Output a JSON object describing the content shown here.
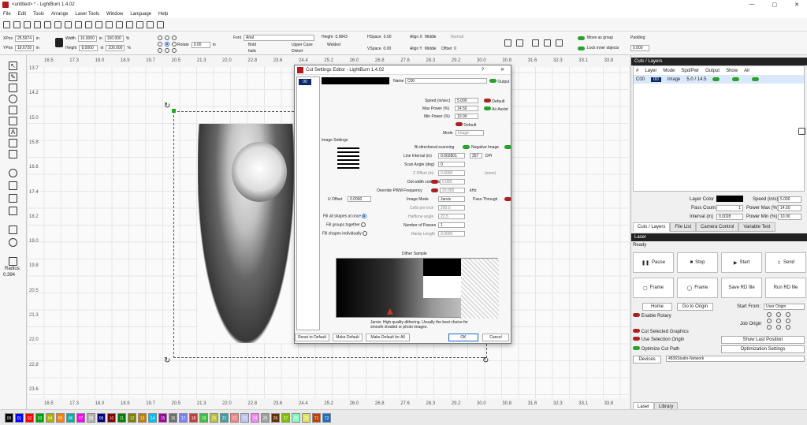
{
  "window": {
    "title": "<untitled> * - LightBurn 1.4.02",
    "controls": [
      "—",
      "▢",
      "✕"
    ]
  },
  "menu": [
    "File",
    "Edit",
    "Tools",
    "Arrange",
    "Laser Tools",
    "Window",
    "Language",
    "Help"
  ],
  "props": {
    "xpos_label": "XPos",
    "xpos": "25.5974",
    "ypos_label": "YPos",
    "ypos": "18.6728",
    "unit": "in",
    "width_label": "Width",
    "width": "10.0000",
    "height_label": "Height",
    "height": "8.0000",
    "wpct": "100.000",
    "hpct": "100.000",
    "pct": "%",
    "rotate_label": "Rotate",
    "rotate": "0.00",
    "font_label": "Font",
    "font": "Arial",
    "fheight_label": "Height",
    "fheight": "0.9843",
    "hspace_label": "HSpace",
    "hspace": "0.00",
    "vspace_label": "VSpace",
    "vspace": "0.00",
    "alignx_label": "Align X",
    "alignx": "Middle",
    "aligny_label": "Align Y",
    "aligny": "Middle",
    "normal": "Normal",
    "offset_label": "Offset",
    "offset": "0",
    "bold": "Bold",
    "italic": "Italic",
    "upper": "Upper Case",
    "distort": "Distort",
    "welded": "Welded",
    "move_group": "Move as group",
    "lock_inner": "Lock inner objects",
    "padding_label": "Padding:",
    "padding": "0.000"
  },
  "rulers": {
    "top": [
      "16.5",
      "17.3",
      "18.0",
      "18.9",
      "19.7",
      "20.5",
      "21.3",
      "22.0",
      "22.8",
      "23.6",
      "24.4",
      "25.2",
      "26.0",
      "26.8",
      "27.6",
      "28.3",
      "29.2",
      "30.0",
      "30.8",
      "31.6",
      "32.3",
      "33.1",
      "33.8"
    ],
    "left": [
      "13.7",
      "14.2",
      "15.0",
      "15.8",
      "16.6",
      "17.4",
      "18.2",
      "19.0",
      "19.8",
      "20.5",
      "21.3",
      "22.0",
      "22.8",
      "23.6"
    ],
    "radius_label": "Radius:",
    "radius": "0.394"
  },
  "dialog": {
    "title": "Cut Settings Editor - LightBurn 1.4.02",
    "help": "?",
    "close": "✕",
    "list_item": "00",
    "name_label": "Name",
    "name": "C00",
    "output": "Output",
    "speed_label": "Speed (in/sec)",
    "speed": "5.000",
    "default_label": "Default",
    "max_power_label": "Max Power (%)",
    "max_power": "14.50",
    "air_assist": "Air Assist",
    "min_power_label": "Min Power (%)",
    "min_power": "10.00",
    "default_btn": "Default",
    "mode_label": "Mode",
    "mode": "Image",
    "image_settings": "Image Settings",
    "bidir": "Bi-directional scanning",
    "negative": "Negative Image",
    "line_interval_label": "Line Interval (in)",
    "line_interval": "0.002801",
    "dpi": "357",
    "dpi_label": "DPI",
    "scan_angle_label": "Scan Angle (deg)",
    "scan_angle": "0",
    "z_offset_label": "Z Offset (in)",
    "z_offset": "0.0000",
    "none": "(none)",
    "dot_width_label": "Dot width correction",
    "dot_width": "0.080",
    "override_label": "Override PWM Frequency",
    "override": "20.000",
    "khz": "kHz",
    "u_offset_label": "U Offset",
    "u_offset": "0.0000",
    "image_mode_label": "Image Mode",
    "image_mode": "Jarvis",
    "pass_through": "Pass-Through",
    "cells_label": "Cells per inch",
    "cells": "200.0",
    "halftone_label": "Halftone angle",
    "halftone": "22.5",
    "passes_label": "Number of Passes",
    "passes": "1",
    "ramp_label": "Ramp Length",
    "ramp": "0.0000",
    "fill_all": "Fill all shapes at once",
    "fill_groups": "Fill groups together",
    "fill_indiv": "Fill shapes individually",
    "dither_title": "Dither Sample",
    "dither_caption": "Jarvis: High quality dithering. Usually the best choice for smooth shaded or photo images.",
    "btn_reset": "Reset to Default",
    "btn_make": "Make Default",
    "btn_make_all": "Make Default for All",
    "btn_ok": "OK",
    "btn_cancel": "Cancel"
  },
  "layers": {
    "header": "Cuts / Layers",
    "columns": [
      "#",
      "Layer",
      "Mode",
      "Spd/Pwr",
      "Output",
      "Show",
      "Air"
    ],
    "row": {
      "num": "C00",
      "layer": "00",
      "mode": "Image",
      "spdpwr": "5.0 / 14.5"
    },
    "layer_color_label": "Layer Color",
    "speed_label": "Speed (in/s)",
    "speed": "5.000",
    "pass_count_label": "Pass Count",
    "pass_count": "1",
    "power_max_label": "Power Max (%)",
    "power_max": "14.50",
    "interval_label": "Interval (in)",
    "interval": "0.0028",
    "power_min_label": "Power Min (%)",
    "power_min": "10.00",
    "image_label": "Image",
    "tabs": [
      "Cuts / Layers",
      "File List",
      "Camera Control",
      "Variable Text"
    ]
  },
  "laser": {
    "header": "Laser",
    "status": "Ready",
    "pause": "Pause",
    "stop": "Stop",
    "start": "Start",
    "send": "Send",
    "frame1": "Frame",
    "frame2": "Frame",
    "save_rd": "Save RD file",
    "run_rd": "Run RD file",
    "home": "Home",
    "go_origin": "Go to Origin",
    "start_from_label": "Start From:",
    "start_from": "User Origin",
    "enable_rotary": "Enable Rotary",
    "job_origin": "Job Origin",
    "cut_selected": "Cut Selected Graphics",
    "use_selection_origin": "Use Selection Origin",
    "show_last": "Show Last Position",
    "optimize": "Optimize Cut Path",
    "opt_settings": "Optimization Settings",
    "devices": "Devices",
    "device": "4836Studio-Network",
    "tabs": [
      "Laser",
      "Library"
    ]
  },
  "palette": [
    {
      "label": "00",
      "color": "#000000"
    },
    {
      "label": "01",
      "color": "#0000ff"
    },
    {
      "label": "02",
      "color": "#ff0000"
    },
    {
      "label": "03",
      "color": "#00a000"
    },
    {
      "label": "04",
      "color": "#b0b000"
    },
    {
      "label": "05",
      "color": "#ff8000"
    },
    {
      "label": "06",
      "color": "#00b0b0"
    },
    {
      "label": "07",
      "color": "#ff00ff"
    },
    {
      "label": "08",
      "color": "#b4b4b4"
    },
    {
      "label": "09",
      "color": "#000080"
    },
    {
      "label": "10",
      "color": "#800000"
    },
    {
      "label": "11",
      "color": "#008000"
    },
    {
      "label": "12",
      "color": "#808000"
    },
    {
      "label": "13",
      "color": "#c08000"
    },
    {
      "label": "14",
      "color": "#00c0ff"
    },
    {
      "label": "15",
      "color": "#a000a0"
    },
    {
      "label": "16",
      "color": "#707070"
    },
    {
      "label": "17",
      "color": "#8080ff"
    },
    {
      "label": "18",
      "color": "#c04040"
    },
    {
      "label": "19",
      "color": "#40c040"
    },
    {
      "label": "20",
      "color": "#c0c040"
    },
    {
      "label": "21",
      "color": "#40a0a0"
    },
    {
      "label": "22",
      "color": "#ff8080"
    },
    {
      "label": "23",
      "color": "#c0c0ff"
    },
    {
      "label": "24",
      "color": "#ff80ff"
    },
    {
      "label": "25",
      "color": "#a0a0a0"
    },
    {
      "label": "26",
      "color": "#603000"
    },
    {
      "label": "27",
      "color": "#80c000"
    },
    {
      "label": "28",
      "color": "#80ffc0"
    },
    {
      "label": "29",
      "color": "#e0e060"
    },
    {
      "label": "T1",
      "color": "#c04000"
    },
    {
      "label": "T2",
      "color": "#1a70c0"
    }
  ]
}
